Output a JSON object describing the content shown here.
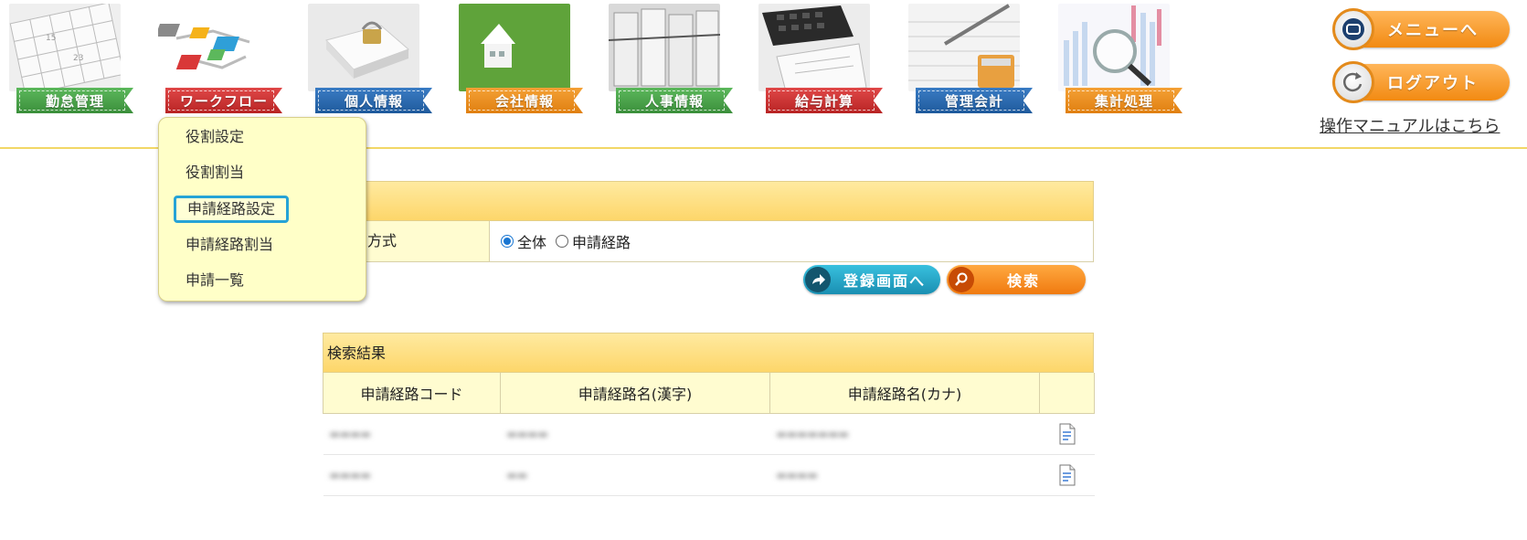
{
  "nav": {
    "items": [
      {
        "label": "勤怠管理",
        "icon": "calendar-icon"
      },
      {
        "label": "ワークフロー",
        "icon": "workflow-blocks-icon"
      },
      {
        "label": "個人情報",
        "icon": "padlock-book-icon"
      },
      {
        "label": "会社情報",
        "icon": "house-on-grass-icon"
      },
      {
        "label": "人事情報",
        "icon": "file-folders-icon"
      },
      {
        "label": "給与計算",
        "icon": "calculator-payslip-icon"
      },
      {
        "label": "管理会計",
        "icon": "ledger-pen-icon"
      },
      {
        "label": "集計処理",
        "icon": "magnifier-chart-icon"
      }
    ],
    "menu_button": "メニューへ",
    "logout_button": "ログアウト",
    "manual_link": "操作マニュアルはこちら"
  },
  "dropdown": {
    "items": [
      {
        "label": "役割設定"
      },
      {
        "label": "役割割当"
      },
      {
        "label": "申請経路設定"
      },
      {
        "label": "申請経路割当"
      },
      {
        "label": "申請一覧"
      }
    ],
    "selected_index": 2
  },
  "search": {
    "row_label": "方式",
    "options": [
      {
        "label": "全体"
      },
      {
        "label": "申請経路"
      }
    ],
    "selected_option": "全体",
    "register_button": "登録画面へ",
    "search_button": "検索"
  },
  "results": {
    "title": "検索結果",
    "columns": [
      "申請経路コード",
      "申請経路名(漢字)",
      "申請経路名(カナ)",
      ""
    ],
    "rows": [
      {
        "code": "",
        "name_kanji": "",
        "name_kana": ""
      },
      {
        "code": "",
        "name_kanji": "",
        "name_kana": ""
      }
    ]
  },
  "colors": {
    "accent_yellow": "#fdd66a",
    "selection_outline": "#26a3d6",
    "orange_button": "#f28a12",
    "teal_button": "#1a8fb2"
  }
}
